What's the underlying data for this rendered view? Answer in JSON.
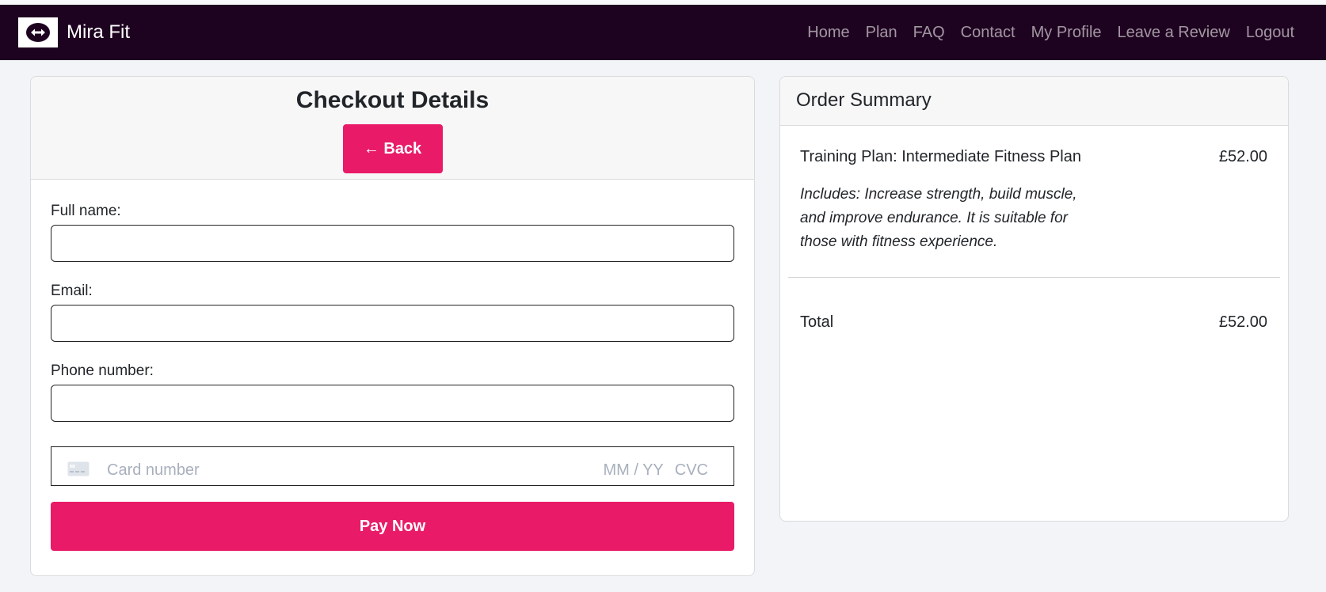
{
  "brand": {
    "name": "Mira Fit",
    "logo_icon": "arrows-left-right-icon"
  },
  "nav": {
    "links": [
      "Home",
      "Plan",
      "FAQ",
      "Contact",
      "My Profile",
      "Leave a Review",
      "Logout"
    ]
  },
  "checkout": {
    "title": "Checkout Details",
    "back_label": "← Back",
    "fields": {
      "full_name_label": "Full name:",
      "full_name_value": "",
      "email_label": "Email:",
      "email_value": "",
      "phone_label": "Phone number:",
      "phone_value": ""
    },
    "card": {
      "icon": "credit-card-icon",
      "number_placeholder": "Card number",
      "expiry_placeholder": "MM / YY",
      "cvc_placeholder": "CVC"
    },
    "pay_label": "Pay Now"
  },
  "summary": {
    "title": "Order Summary",
    "item": {
      "name": "Training Plan: Intermediate Fitness Plan",
      "price": "£52.00",
      "description": "Includes: Increase strength, build muscle,\nand improve endurance. It is suitable for\nthose with fitness experience."
    },
    "total_label": "Total",
    "total_value": "£52.00"
  },
  "colors": {
    "navbar": "#1e0320",
    "accent": "#e91b68",
    "page_bg": "#f2f4f7"
  }
}
